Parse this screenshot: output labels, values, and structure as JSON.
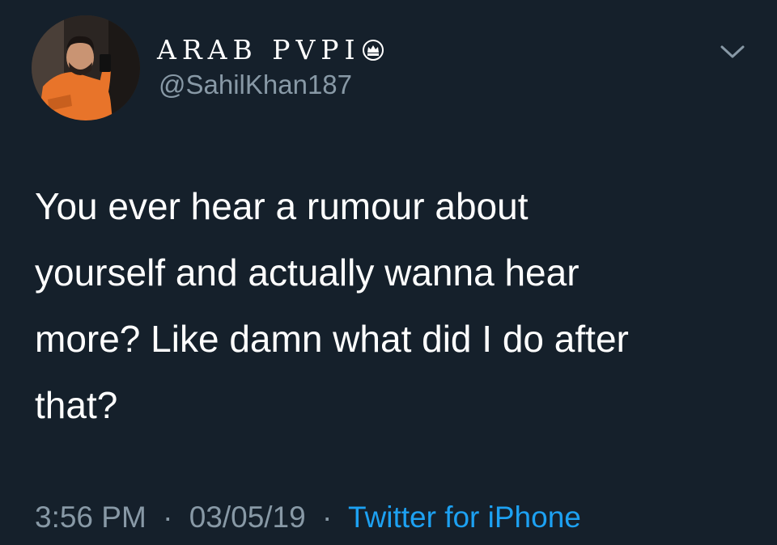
{
  "user": {
    "display_name": "ARAB PVPI",
    "handle": "@SahilKhan187",
    "verified_badge_icon": "crown-icon",
    "avatar_icon": "profile-photo"
  },
  "tweet": {
    "text": "You ever hear a rumour about\nyourself and actually wanna hear\nmore? Like damn what did I do after\nthat?"
  },
  "meta": {
    "time": "3:56 PM",
    "separator": "·",
    "date": "03/05/19",
    "source": "Twitter for iPhone"
  },
  "menu": {
    "icon": "chevron-down-icon"
  },
  "colors": {
    "background": "#15202b",
    "primary_text": "#ffffff",
    "secondary_text": "#8899a6",
    "link": "#1da1f2"
  }
}
